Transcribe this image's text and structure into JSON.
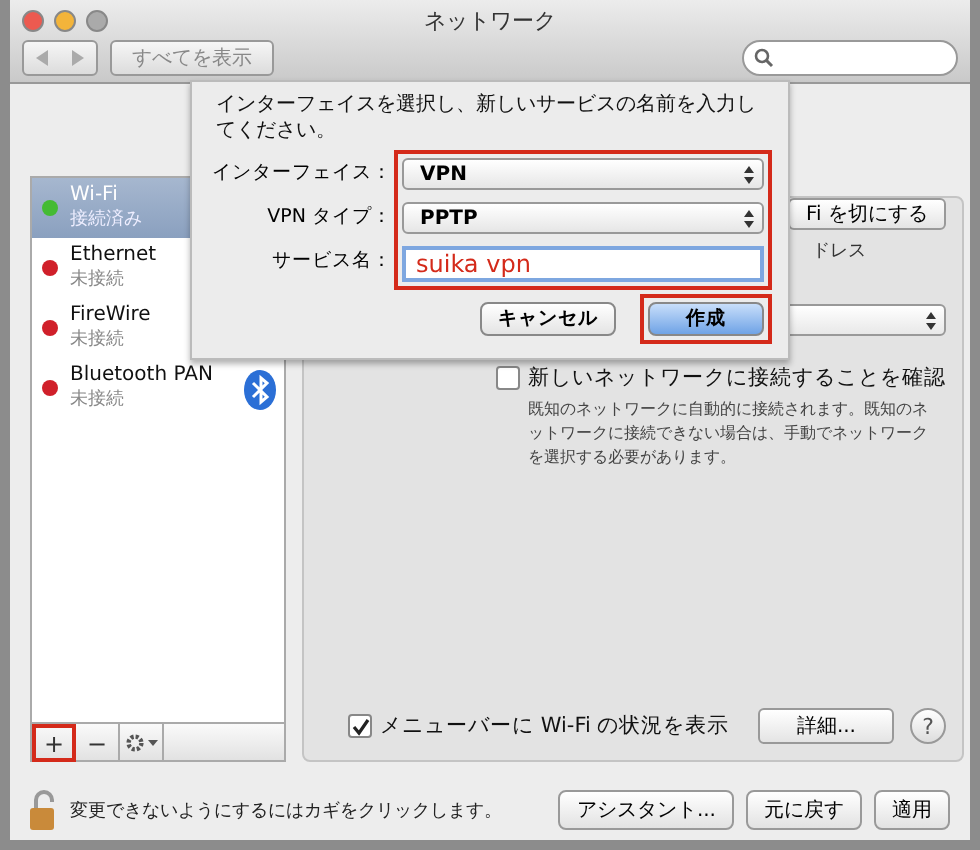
{
  "window": {
    "title": "ネットワーク",
    "show_all_button": "すべてを表示"
  },
  "services": [
    {
      "kind": "wifi",
      "name": "Wi-Fi",
      "status": "接続済み",
      "color": "#44bb33",
      "selected": true
    },
    {
      "kind": "ethernet",
      "name": "Ethernet",
      "status": "未接続",
      "color": "#d0202a",
      "selected": false
    },
    {
      "kind": "firewire",
      "name": "FireWire",
      "status": "未接続",
      "color": "#d0202a",
      "selected": false
    },
    {
      "kind": "bluetooth",
      "name": "Bluetooth PAN",
      "status": "未接続",
      "color": "#d0202a",
      "selected": false
    }
  ],
  "list_buttons": [
    {
      "kind": "add",
      "label": "+",
      "highlighted": true
    },
    {
      "kind": "remove",
      "label": "−",
      "highlighted": false
    },
    {
      "kind": "action",
      "highlighted": false
    }
  ],
  "detail": {
    "wifi_button": "Fi を切にする",
    "address_note": "ドレス",
    "ask_join": {
      "label": "新しいネットワークに接続することを確認",
      "checked": false,
      "description": "既知のネットワークに自動的に接続されます。既知のネットワークに接続できない場合は、手動でネットワークを選択する必要があります。"
    },
    "menu_bar": {
      "label": "メニューバーに Wi-Fi の状況を表示",
      "checked": true
    },
    "advanced_button": "詳細...",
    "help_button": "?"
  },
  "footer": {
    "lock_text": "変更できないようにするにはカギをクリックします。",
    "buttons": [
      "アシスタント...",
      "元に戻す",
      "適用"
    ]
  },
  "dialog": {
    "message": "インターフェイスを選択し、新しいサービスの名前を入力してください。",
    "fields_highlighted": true,
    "fields": [
      {
        "kind": "popup",
        "label": "インターフェイス：",
        "value": "VPN"
      },
      {
        "kind": "popup",
        "label": "VPN タイプ：",
        "value": "PPTP"
      },
      {
        "kind": "text",
        "label": "サービス名：",
        "value": "suika vpn"
      }
    ],
    "buttons": [
      {
        "label": "キャンセル",
        "default": false,
        "highlighted": false
      },
      {
        "label": "作成",
        "default": true,
        "highlighted": true
      }
    ]
  }
}
